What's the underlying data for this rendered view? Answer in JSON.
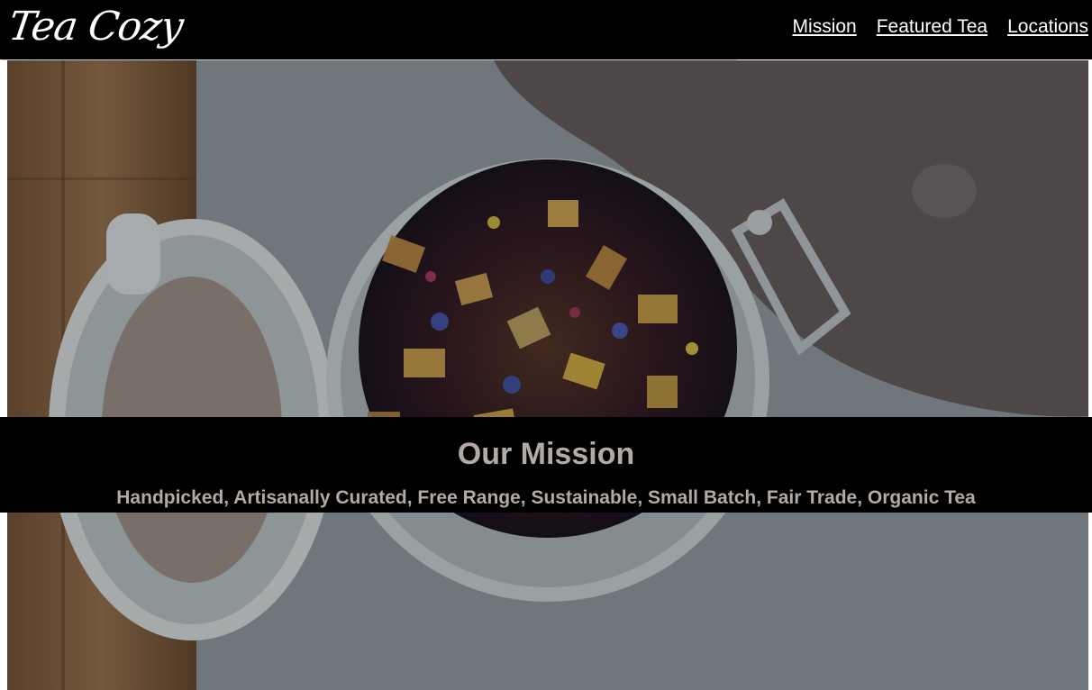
{
  "header": {
    "logo_text": "Tea Cozy",
    "nav": [
      {
        "label": "Mission"
      },
      {
        "label": "Featured Tea"
      },
      {
        "label": "Locations"
      }
    ]
  },
  "hero": {
    "image_icon": "tea-jar-photo"
  },
  "mission": {
    "title": "Our Mission",
    "tagline": "Handpicked, Artisanally Curated, Free Range, Sustainable, Small Batch, Fair Trade, Organic Tea"
  }
}
